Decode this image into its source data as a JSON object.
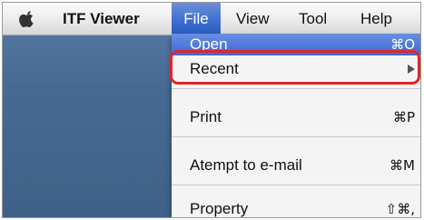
{
  "menubar": {
    "apple_icon": "apple-icon",
    "app_name": "ITF Viewer",
    "menus": [
      "File",
      "View",
      "Tool",
      "Help"
    ]
  },
  "file_menu": {
    "items": [
      {
        "label": "Open",
        "shortcut": "⌘O",
        "highlighted": true
      },
      {
        "label": "Recent",
        "submenu": true,
        "outlined": true
      },
      {
        "label": "Print",
        "shortcut": "⌘P"
      },
      {
        "label": "Atempt to e-mail",
        "shortcut": "⌘M"
      },
      {
        "label": "Property",
        "shortcut": "⇧⌘,"
      }
    ]
  },
  "colors": {
    "menu_highlight": "#3e6fd0",
    "outline": "#e0262b",
    "desktop": "#4a6d96"
  }
}
